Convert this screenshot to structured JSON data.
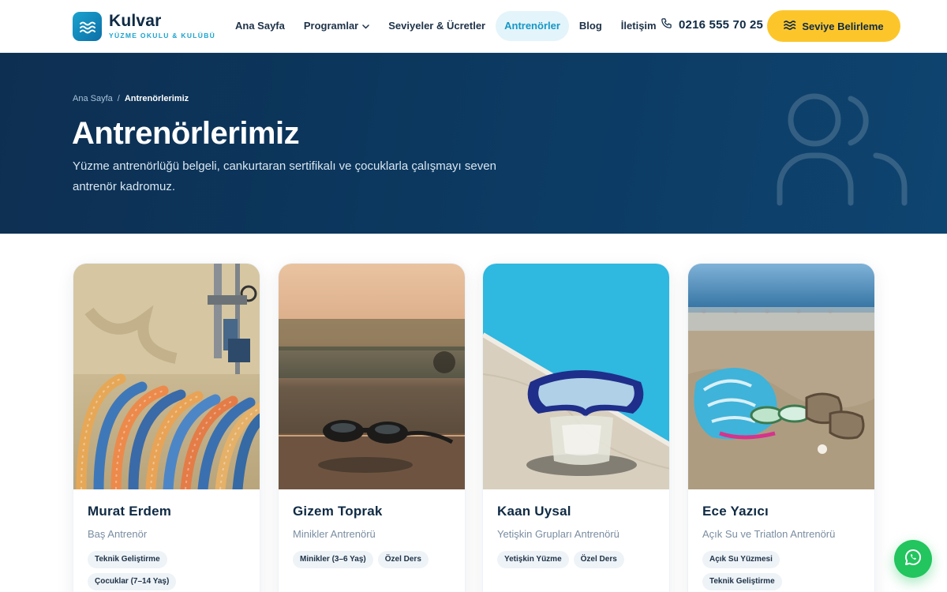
{
  "brand": {
    "name": "Kulvar",
    "tagline": "YÜZME OKULU & KULÜBÜ"
  },
  "nav": {
    "items": [
      {
        "label": "Ana Sayfa"
      },
      {
        "label": "Programlar",
        "has_dropdown": true
      },
      {
        "label": "Seviyeler & Ücretler"
      },
      {
        "label": "Antrenörler",
        "active": true
      },
      {
        "label": "Blog"
      },
      {
        "label": "İletişim"
      }
    ]
  },
  "header": {
    "phone": "0216 555 70 25",
    "cta_label": "Seviye Belirleme",
    "cta_color": "#fcc62b"
  },
  "hero": {
    "breadcrumb": {
      "home": "Ana Sayfa",
      "separator": "/",
      "current": "Antrenörlerimiz"
    },
    "title": "Antrenörlerimiz",
    "description": "Yüzme antrenörlüğü belgeli, cankurtaran sertifikalı ve çocuklarla çalışmayı seven antrenör kadromuz."
  },
  "coaches": [
    {
      "name": "Murat Erdem",
      "role": "Baş Antrenör",
      "tags": [
        "Teknik Geliştirme",
        "Çocuklar (7–14 Yaş)"
      ]
    },
    {
      "name": "Gizem Toprak",
      "role": "Minikler Antrenörü",
      "tags": [
        "Minikler (3–6 Yaş)",
        "Özel Ders"
      ]
    },
    {
      "name": "Kaan Uysal",
      "role": "Yetişkin Grupları Antrenörü",
      "tags": [
        "Yetişkin Yüzme",
        "Özel Ders"
      ]
    },
    {
      "name": "Ece Yazıcı",
      "role": "Açık Su ve Triatlon Antrenörü",
      "tags": [
        "Açık Su Yüzmesi",
        "Teknik Geliştirme"
      ]
    }
  ],
  "colors": {
    "accent": "#1597c6",
    "navy": "#0f2a44",
    "whatsapp": "#22c55e"
  }
}
